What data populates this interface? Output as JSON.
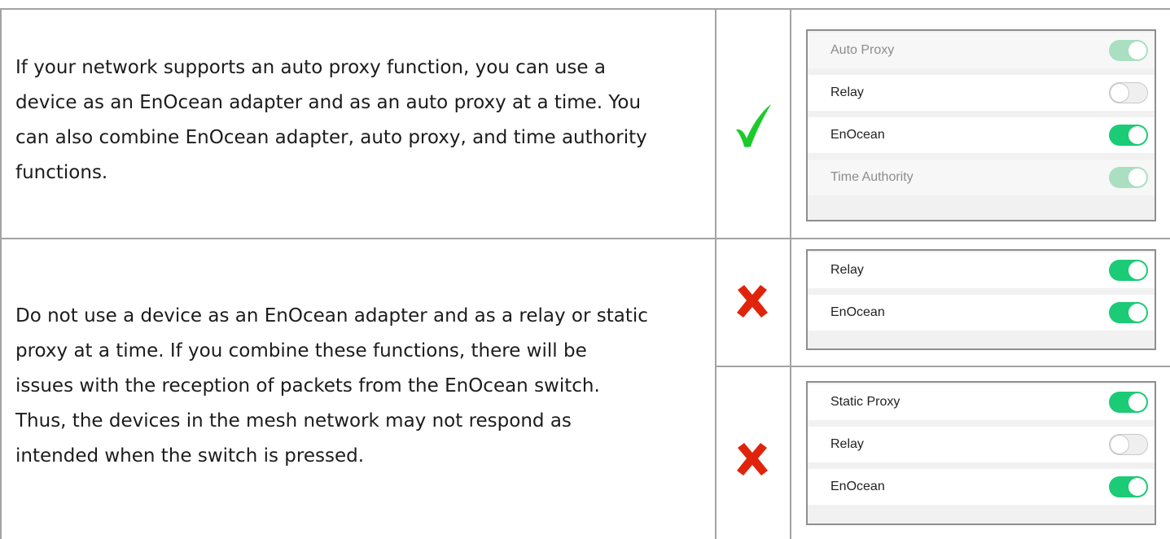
{
  "rows": [
    {
      "description": [
        "If your network supports an auto proxy function, you can use a",
        "device as an EnOcean adapter and as an auto proxy at a time. You",
        "can also combine EnOcean adapter, auto proxy, and time authority",
        "functions."
      ],
      "verdict_icon": "checkmark-icon",
      "verdict_color": "#1ccb2a",
      "panel": [
        {
          "label": "Auto Proxy",
          "state": "on",
          "disabled": true
        },
        {
          "label": "Relay",
          "state": "off",
          "disabled": false
        },
        {
          "label": "EnOcean",
          "state": "on",
          "disabled": false
        },
        {
          "label": "Time Authority",
          "state": "on",
          "disabled": true
        }
      ]
    },
    {
      "description": [
        "Do not use a device as an EnOcean adapter and as a relay or static",
        "proxy at a time. If you combine these functions, there will be",
        "issues with the reception of packets from the EnOcean switch.",
        "Thus, the devices in the mesh network may not respond as",
        "intended when the switch is pressed."
      ],
      "examples": [
        {
          "verdict_icon": "cross-icon",
          "verdict_color": "#e0240c",
          "panel": [
            {
              "label": "Relay",
              "state": "on",
              "disabled": false
            },
            {
              "label": "EnOcean",
              "state": "on",
              "disabled": false
            }
          ]
        },
        {
          "verdict_icon": "cross-icon",
          "verdict_color": "#e0240c",
          "panel": [
            {
              "label": "Static Proxy",
              "state": "on",
              "disabled": false
            },
            {
              "label": "Relay",
              "state": "off",
              "disabled": false
            },
            {
              "label": "EnOcean",
              "state": "on",
              "disabled": false
            }
          ]
        }
      ]
    }
  ],
  "toggle_on_color": "#1ccb75",
  "toggle_disabled_on_color": "#aadfc2"
}
